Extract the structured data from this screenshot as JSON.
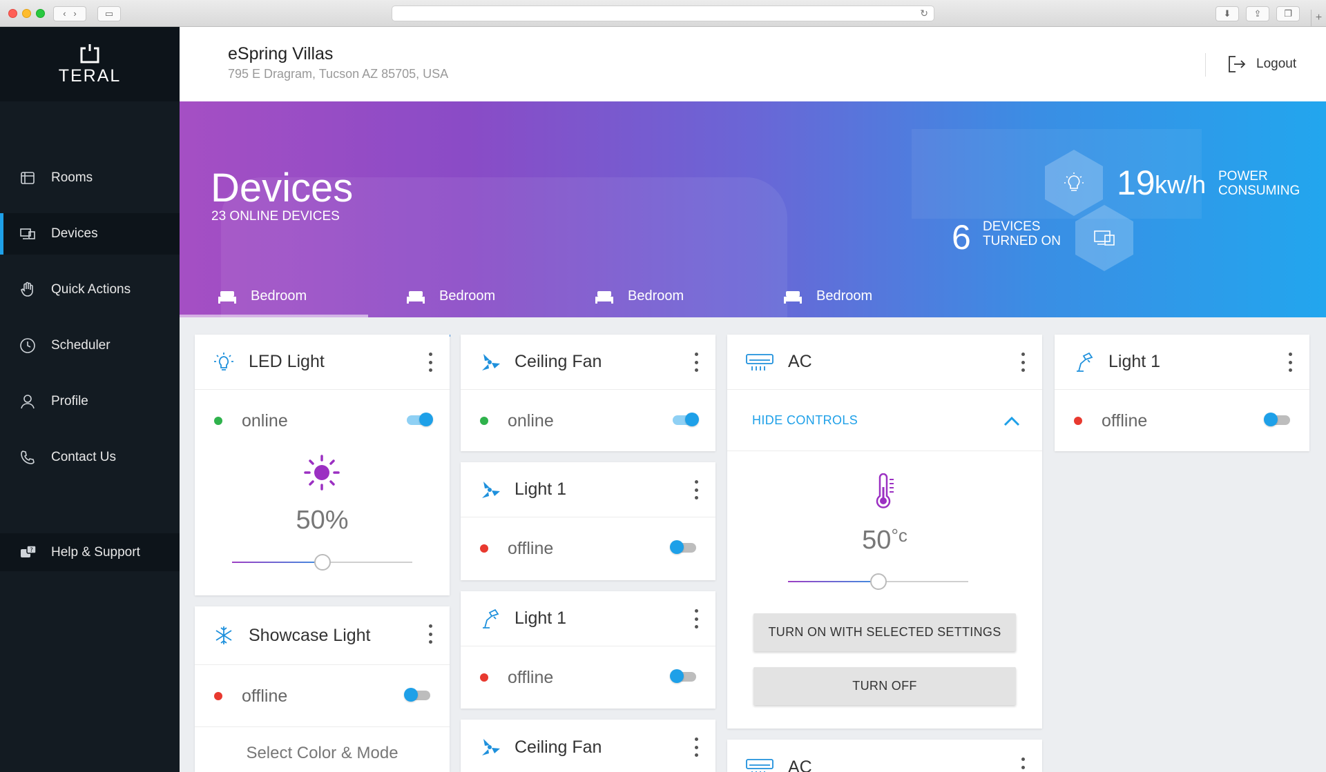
{
  "property": {
    "name": "eSpring Villas",
    "address": "795 E Dragram, Tucson AZ 85705, USA"
  },
  "header": {
    "logout_label": "Logout"
  },
  "brand": {
    "logo_text": "TERAL",
    "accent": "#1ea0e8"
  },
  "sidebar": {
    "items": [
      {
        "label": "Rooms",
        "icon": "rooms-icon"
      },
      {
        "label": "Devices",
        "icon": "devices-icon",
        "active": true
      },
      {
        "label": "Quick Actions",
        "icon": "hand-icon"
      },
      {
        "label": "Scheduler",
        "icon": "clock-icon"
      },
      {
        "label": "Profile",
        "icon": "user-icon"
      },
      {
        "label": "Contact Us",
        "icon": "phone-icon"
      }
    ],
    "help_label": "Help & Support"
  },
  "banner": {
    "title": "Devices",
    "subtitle": "23 ONLINE DEVICES",
    "power_value": "19",
    "power_unit": "kw/h",
    "power_label_1": "POWER",
    "power_label_2": "CONSUMING",
    "devices_on_value": "6",
    "devices_on_label_1": "DEVICES",
    "devices_on_label_2": "TURNED ON",
    "tabs": [
      {
        "label": "Bedroom",
        "active": true
      },
      {
        "label": "Bedroom"
      },
      {
        "label": "Bedroom"
      },
      {
        "label": "Bedroom"
      }
    ]
  },
  "cards": {
    "led": {
      "title": "LED Light",
      "status": "online",
      "state": "on",
      "brightness_label": "50%",
      "brightness": 0.5
    },
    "showcase": {
      "title": "Showcase Light",
      "status": "offline",
      "state": "off",
      "select_label": "Select Color & Mode"
    },
    "fan1": {
      "title": "Ceiling Fan",
      "status": "online",
      "state": "on"
    },
    "light_a": {
      "title": "Light 1",
      "status": "offline",
      "state": "off"
    },
    "light_b": {
      "title": "Light 1",
      "status": "offline",
      "state": "off"
    },
    "fan2": {
      "title": "Ceiling Fan"
    },
    "ac1": {
      "title": "AC",
      "hide_controls_label": "HIDE CONTROLS",
      "temp_value": "50",
      "temp_unit": "°c",
      "temp_level": 0.5,
      "turn_on_label": "TURN ON WITH SELECTED SETTINGS",
      "turn_off_label": "TURN OFF"
    },
    "ac2": {
      "title": "AC"
    },
    "light_c": {
      "title": "Light 1",
      "status": "offline",
      "state": "off"
    }
  },
  "colors": {
    "online": "#2fb24c",
    "offline": "#e8392f",
    "primary": "#1ea0e8"
  }
}
